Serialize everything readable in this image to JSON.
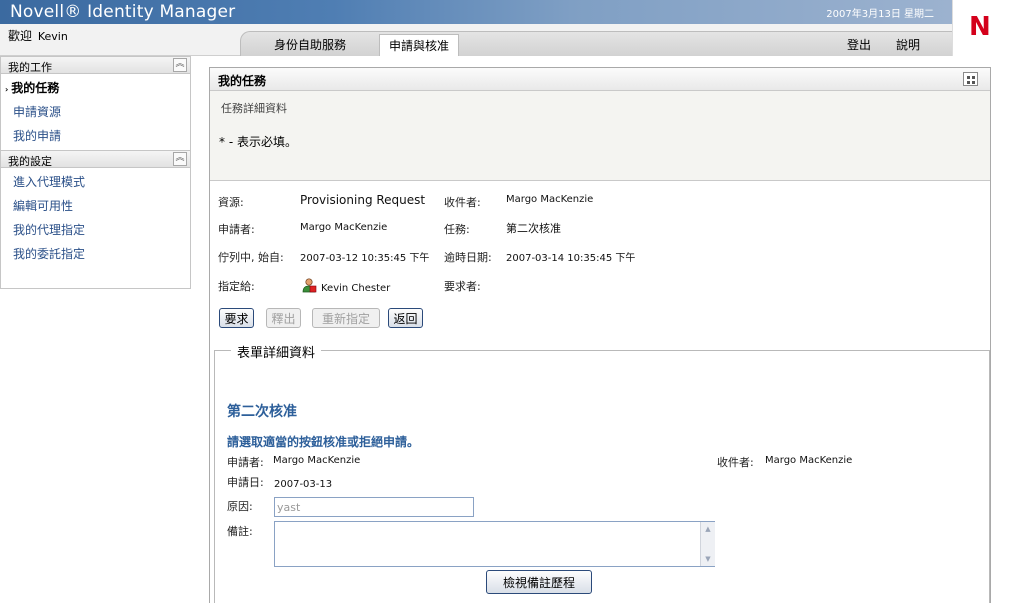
{
  "header": {
    "app_title": "Novell® Identity Manager",
    "date": "2007年3月13日 星期二",
    "logo_letter": "N"
  },
  "nav": {
    "welcome_label": "歡迎",
    "user_name": "Kevin",
    "tabs": [
      {
        "label": "身份自助服務",
        "selected": false
      },
      {
        "label": "申請與核准",
        "selected": true
      }
    ],
    "logout_label": "登出",
    "help_label": "說明"
  },
  "sidebar": {
    "sections": [
      {
        "title": "我的工作",
        "items": [
          {
            "label": "我的任務",
            "active": true
          },
          {
            "label": "申請資源",
            "active": false
          },
          {
            "label": "我的申請",
            "active": false
          }
        ]
      },
      {
        "title": "我的設定",
        "items": [
          {
            "label": "進入代理模式",
            "active": false
          },
          {
            "label": "編輯可用性",
            "active": false
          },
          {
            "label": "我的代理指定",
            "active": false
          },
          {
            "label": "我的委託指定",
            "active": false
          }
        ]
      }
    ]
  },
  "main": {
    "panel_title": "我的任務",
    "detail_subtitle": "任務詳細資料",
    "required_note": "* - 表示必填。",
    "fields": {
      "resource_label": "資源:",
      "resource_value": "Provisioning Request",
      "recipient_label": "收件者:",
      "recipient_value": "Margo MacKenzie",
      "requester_label": "申請者:",
      "requester_value": "Margo MacKenzie",
      "task_label": "任務:",
      "task_value": "第二次核准",
      "queued_label": "佇列中, 始自:",
      "queued_value": "2007-03-12 10:35:45 下午",
      "timeout_label": "逾時日期:",
      "timeout_value": "2007-03-14 10:35:45 下午",
      "assigned_label": "指定給:",
      "assigned_value": "Kevin Chester",
      "requested_by_label": "要求者:"
    },
    "buttons": {
      "claim": "要求",
      "release": "釋出",
      "reassign": "重新指定",
      "back": "返回"
    }
  },
  "form": {
    "legend": "表單詳細資料",
    "title": "第二次核准",
    "instruction": "請選取適當的按鈕核准或拒絕申請。",
    "requester_label": "申請者:",
    "requester_value": "Margo MacKenzie",
    "recipient_label": "收件者:",
    "recipient_value": "Margo MacKenzie",
    "request_date_label": "申請日:",
    "request_date_value": "2007-03-13",
    "reason_label": "原因:",
    "reason_value": "yast",
    "comment_label": "備註:",
    "comment_value": "",
    "history_button": "檢視備註歷程"
  }
}
